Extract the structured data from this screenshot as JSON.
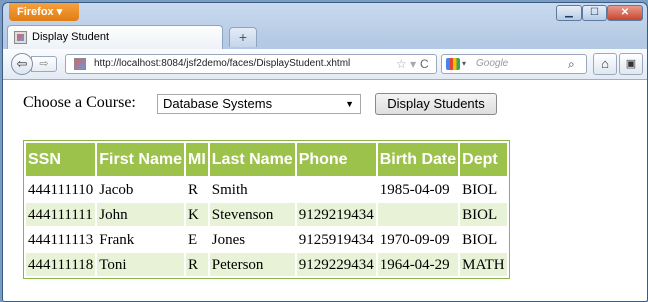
{
  "browser": {
    "menu_label": "Firefox ▾",
    "tab_title": "Display Student",
    "new_tab": "+",
    "url": "http://localhost:8084/jsf2demo/faces/DisplayStudent.xhtml",
    "search_placeholder": "Google",
    "icons": [
      "back-arrow-icon",
      "forward-arrow-icon",
      "favicon-icon",
      "star-icon",
      "reload-icon",
      "google-icon",
      "search-icon",
      "home-icon",
      "bookmarks-icon",
      "minimize-icon",
      "maximize-icon",
      "close-icon"
    ]
  },
  "form": {
    "course_label": "Choose a Course:",
    "course_selected": "Database Systems",
    "display_button": "Display Students"
  },
  "table": {
    "headers": [
      "SSN",
      "First Name",
      "MI",
      "Last Name",
      "Phone",
      "Birth Date",
      "Dept"
    ],
    "rows": [
      [
        "444111110",
        "Jacob",
        "R",
        "Smith",
        "",
        "1985-04-09",
        "BIOL"
      ],
      [
        "444111111",
        "John",
        "K",
        "Stevenson",
        "9129219434",
        "",
        "BIOL"
      ],
      [
        "444111113",
        "Frank",
        "E",
        "Jones",
        "9125919434",
        "1970-09-09",
        "BIOL"
      ],
      [
        "444111118",
        "Toni",
        "R",
        "Peterson",
        "9129229434",
        "1964-04-29",
        "MATH"
      ]
    ]
  },
  "colors": {
    "header_bg": "#9cc24b",
    "row_alt_bg": "#e8f2d6",
    "menu_button": "#e07c14"
  }
}
